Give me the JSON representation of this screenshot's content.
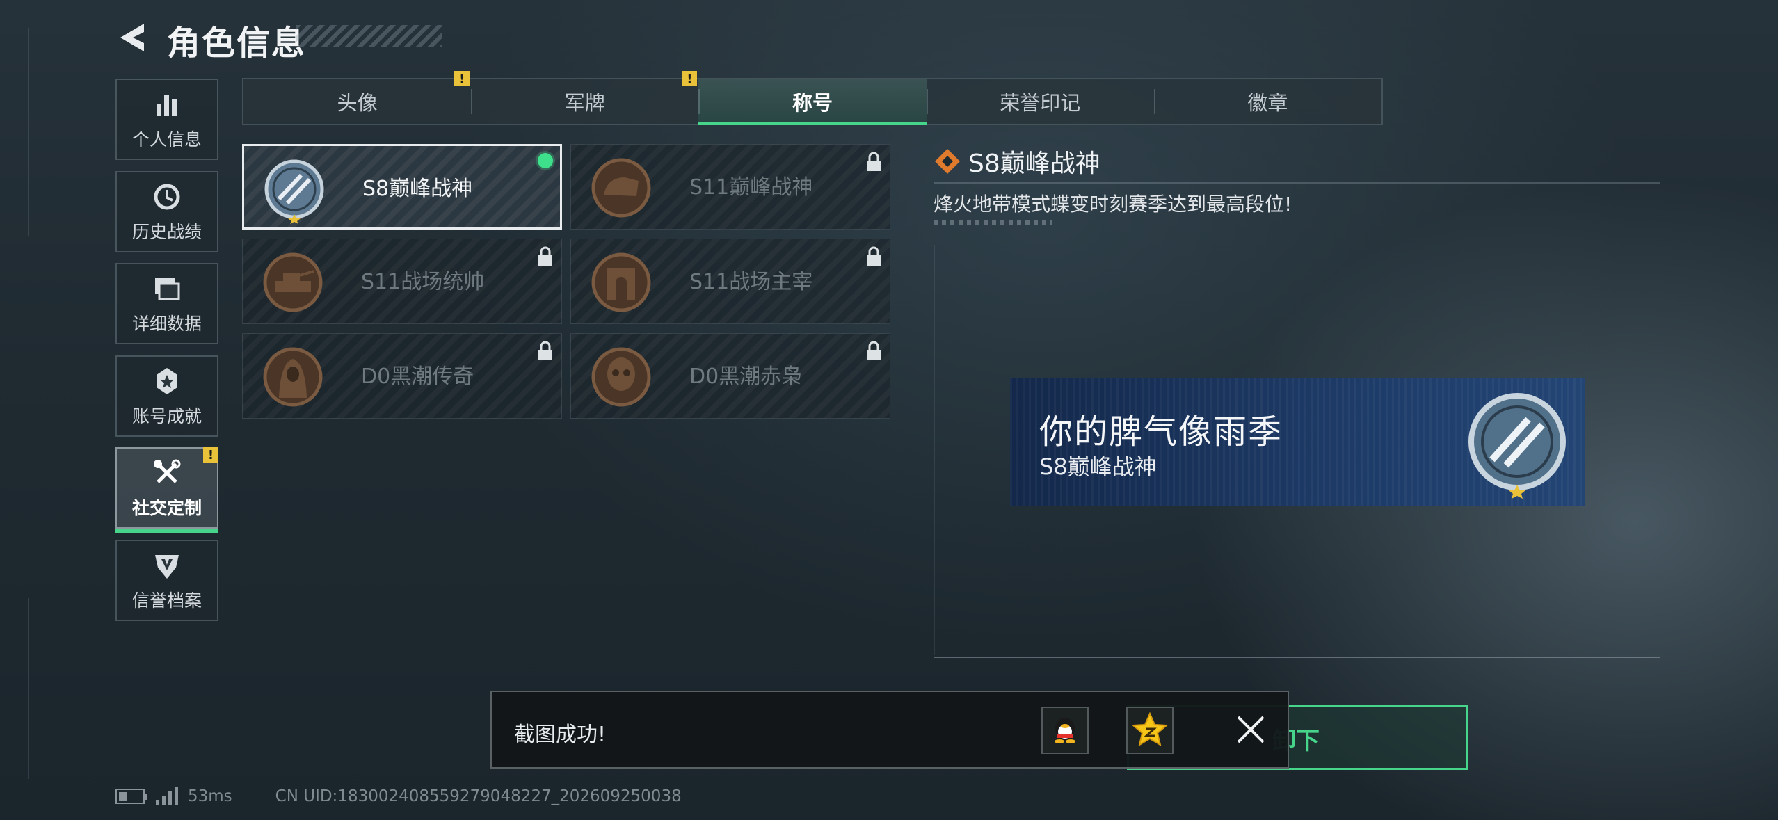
{
  "header": {
    "title": "角色信息"
  },
  "sidebar": {
    "items": [
      {
        "label": "个人信息",
        "icon": "bar-chart-icon",
        "active": false
      },
      {
        "label": "历史战绩",
        "icon": "clock-icon",
        "active": false
      },
      {
        "label": "详细数据",
        "icon": "folders-icon",
        "active": false
      },
      {
        "label": "账号成就",
        "icon": "achievement-medal-icon",
        "active": false
      },
      {
        "label": "社交定制",
        "icon": "tools-icon",
        "active": true,
        "alert": "!"
      },
      {
        "label": "信誉档案",
        "icon": "credibility-shield-icon",
        "active": false
      }
    ]
  },
  "tabs": [
    {
      "label": "头像",
      "alert": "!"
    },
    {
      "label": "军牌",
      "alert": "!"
    },
    {
      "label": "称号",
      "active": true
    },
    {
      "label": "荣誉印记"
    },
    {
      "label": "徽章"
    }
  ],
  "titles": [
    {
      "name": "S8巅峰战神",
      "emblem": "wings-emblem-icon",
      "state": "equipped"
    },
    {
      "name": "S11巅峰战神",
      "emblem": "bronze-helmet-emblem-icon",
      "state": "locked"
    },
    {
      "name": "S11战场统帅",
      "emblem": "bronze-tank-emblem-icon",
      "state": "locked"
    },
    {
      "name": "S11战场主宰",
      "emblem": "bronze-arch-emblem-icon",
      "state": "locked"
    },
    {
      "name": "D0黑潮传奇",
      "emblem": "bronze-hooded-figure-emblem-icon",
      "state": "locked"
    },
    {
      "name": "D0黑潮赤枭",
      "emblem": "bronze-skull-mask-emblem-icon",
      "state": "locked"
    }
  ],
  "detail": {
    "title": "S8巅峰战神",
    "description": "烽火地带模式蝶变时刻赛季达到最高段位!"
  },
  "nameplate": {
    "signature": "你的脾气像雨季",
    "title": "S8巅峰战神"
  },
  "actions": {
    "unequip_label": "卸下"
  },
  "toast": {
    "message": "截图成功!",
    "share_buttons": [
      "qq-icon",
      "qzone-star-icon"
    ]
  },
  "status": {
    "ping": "53ms",
    "uid": "CN UID:18300240855927904822​7_202609250038"
  },
  "colors": {
    "accent": "#47d48b",
    "alert": "#e9c23a",
    "nameplate": "#1d3a66"
  }
}
